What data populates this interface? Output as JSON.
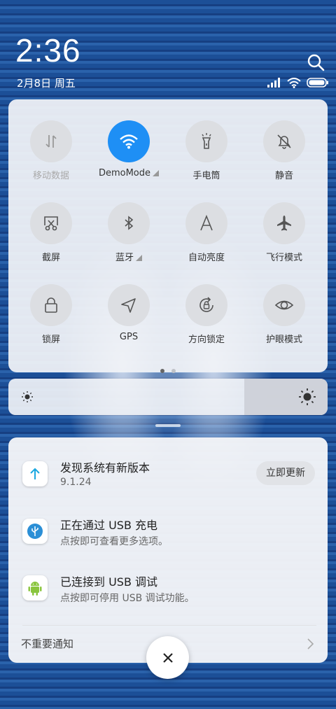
{
  "status_bar": {
    "time": "2:36",
    "date": "2月8日 周五"
  },
  "toggles": [
    {
      "label": "移动数据",
      "icon": "mobile-data-icon",
      "state": "disabled"
    },
    {
      "label": "DemoMode",
      "icon": "wifi-icon",
      "state": "on"
    },
    {
      "label": "手电筒",
      "icon": "flashlight-icon",
      "state": "off"
    },
    {
      "label": "静音",
      "icon": "mute-bell-icon",
      "state": "off"
    },
    {
      "label": "截屏",
      "icon": "screenshot-icon",
      "state": "off"
    },
    {
      "label": "蓝牙",
      "icon": "bluetooth-icon",
      "state": "off"
    },
    {
      "label": "自动亮度",
      "icon": "auto-brightness-icon",
      "state": "off"
    },
    {
      "label": "飞行模式",
      "icon": "airplane-icon",
      "state": "off"
    },
    {
      "label": "锁屏",
      "icon": "lock-icon",
      "state": "off"
    },
    {
      "label": "GPS",
      "icon": "gps-icon",
      "state": "off"
    },
    {
      "label": "方向锁定",
      "icon": "rotation-lock-icon",
      "state": "off"
    },
    {
      "label": "护眼模式",
      "icon": "eye-icon",
      "state": "off"
    }
  ],
  "pager": {
    "pages": 2,
    "current": 1
  },
  "brightness": {
    "level": 0.74
  },
  "notifications": [
    {
      "title": "发现系统有新版本",
      "subtitle": "9.1.24",
      "action": "立即更新",
      "icon": "update-arrow-icon"
    },
    {
      "title": "正在通过 USB 充电",
      "subtitle": "点按即可查看更多选项。",
      "icon": "usb-icon"
    },
    {
      "title": "已连接到 USB 调试",
      "subtitle": "点按即可停用 USB 调试功能。",
      "icon": "android-icon"
    }
  ],
  "unimportant_label": "不重要通知",
  "colors": {
    "accent": "#1e8ff5",
    "wallpaper": "#1b4e95"
  }
}
